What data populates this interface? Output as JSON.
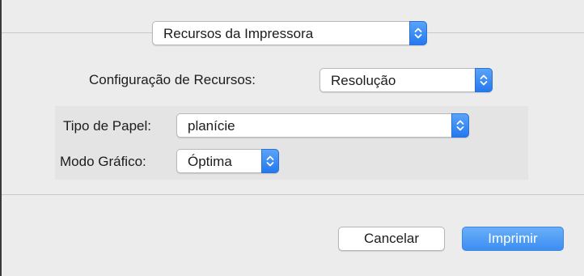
{
  "panel_selector": {
    "value": "Recursos da Impressora"
  },
  "feature_sets": {
    "label": "Configuração de Recursos:",
    "value": "Resolução"
  },
  "paper_type": {
    "label": "Tipo de Papel:",
    "value": "planície"
  },
  "graphics_mode": {
    "label": "Modo Gráfico:",
    "value": "Óptima"
  },
  "buttons": {
    "cancel": "Cancelar",
    "print": "Imprimir"
  },
  "colors": {
    "accent": "#2f83f1",
    "print_button": "#4e9ff6",
    "window_bg": "#ececec",
    "section_bg": "#e4e4e4"
  },
  "icons": {
    "popup_arrows": "updown-chevron-icon"
  }
}
